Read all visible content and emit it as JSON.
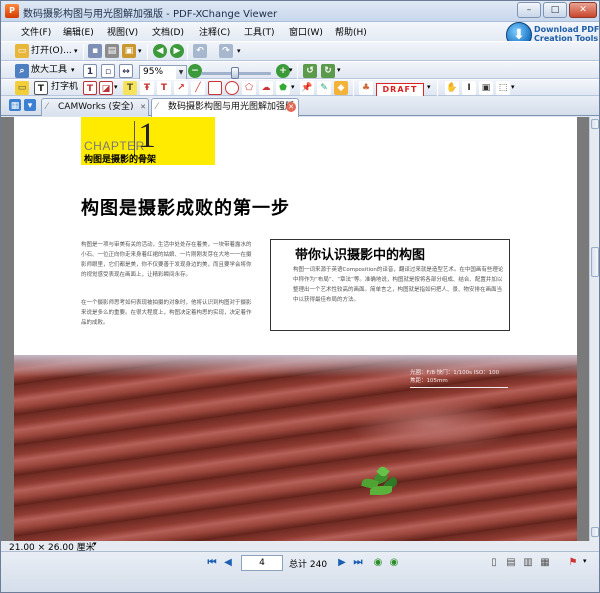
{
  "window": {
    "title": "数码摄影构图与用光图解加强版 - PDF-XChange Viewer",
    "app_icon": "pdf-xchange-icon",
    "controls": {
      "minimize": "–",
      "maximize": "□",
      "close": "✕"
    }
  },
  "menu": {
    "items": [
      "文件(F)",
      "编辑(E)",
      "视图(V)",
      "文档(D)",
      "注释(C)",
      "工具(T)",
      "窗口(W)",
      "帮助(H)"
    ]
  },
  "promo": {
    "line1": "Download PDF",
    "line2": "Creation Tools"
  },
  "toolbar1": {
    "open_label": "打开(O)..."
  },
  "toolbar2": {
    "zoom_tool_label": "放大工具",
    "zoom_value": "95%"
  },
  "toolbar3": {
    "typewriter_label": "打字机",
    "stamp_label": "DRAFT"
  },
  "tabs": [
    {
      "label": "CAMWorks (安全)",
      "active": false
    },
    {
      "label": "数码摄影构图与用光图解加强版",
      "active": true
    }
  ],
  "page": {
    "chapter_word": "CHAPTER",
    "chapter_number": "1",
    "chapter_subtitle": "构图是摄影的骨架",
    "headline": "构图是摄影成败的第一步",
    "left_para1": "构图是一项与审美有关的活动，生活中处处存在着美，一块带着露水的小石、一位正向你走来身着红裙的姑娘、一片刚刚发芽在大地一一在摄影师眼里，它们都是美，你不仅要善于发现身边的美，而且要学会将你的视觉感受表现在画面上，让精彩瞬间永存。",
    "left_para2": "在一个摄影师思考如何表现被拍摄的对象时，他将认识到构图对于摄影来说是多么的重要。在很大程度上，构图决定着构思的实现，决定着作品的成败。",
    "sidebox_title": "带你认识摄影中的构图",
    "sidebox_text": "构图一词来源于英语Composition的译音，翻译过来就是造型艺术。在中国画有些理论中称作为“布局”、“章法”等。准确地说，构图就是按将各部分组成、结合、配置并加以整理出一个艺术性较高的画面。简单言之，构图就是指如何把人、景、物安排在画面当中以获得最佳布局的方法。",
    "photo_caption1": "光圈：F/8  快门：1/100s  ISO：100",
    "photo_caption2": "焦距：105mm"
  },
  "status": {
    "page_size": "21.00 × 26.00 厘米",
    "current_page": "4",
    "total_label": "总计 240"
  },
  "colors": {
    "chapter_bg": "#ffeb00",
    "accent": "#1c5fb4",
    "draft": "#dd2222"
  }
}
